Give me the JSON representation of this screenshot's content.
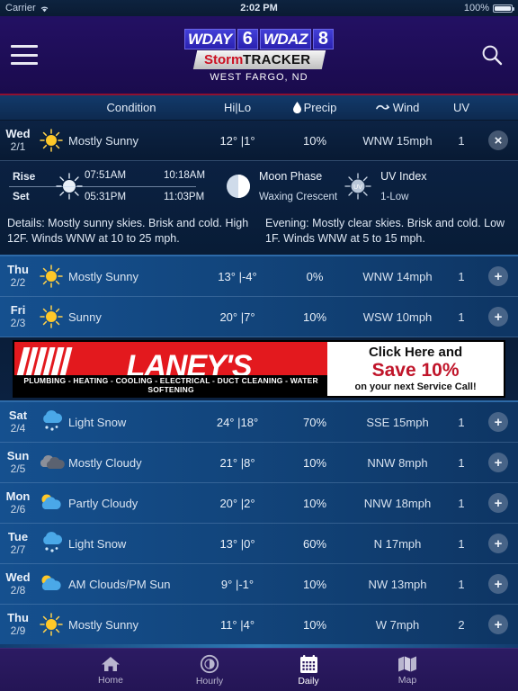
{
  "statusbar": {
    "carrier": "Carrier",
    "time": "2:02 PM",
    "battery": "100%"
  },
  "nav": {
    "menu_icon": "hamburger-icon",
    "search_icon": "search-icon",
    "logo": {
      "box1": "WDAY",
      "num1": "6",
      "box2": "WDAZ",
      "num2": "8",
      "storm": "Storm",
      "tracker": "TRACKER"
    },
    "city": "WEST FARGO, ND"
  },
  "columns": {
    "condition": "Condition",
    "temp": "Hi|Lo",
    "precip": "Precip",
    "wind": "Wind",
    "uv": "UV"
  },
  "forecast": [
    {
      "day": "Wed",
      "date": "2/1",
      "icon": "sunny-icon",
      "condition": "Mostly Sunny",
      "temp": "12° |1°",
      "precip": "10%",
      "wind": "WNW 15mph",
      "uv": "1",
      "expanded": true,
      "button": "×",
      "button_name": "collapse-button"
    },
    {
      "day": "Thu",
      "date": "2/2",
      "icon": "sunny-icon",
      "condition": "Mostly Sunny",
      "temp": "13° |-4°",
      "precip": "0%",
      "wind": "WNW 14mph",
      "uv": "1",
      "expanded": false,
      "button": "+",
      "button_name": "expand-button"
    },
    {
      "day": "Fri",
      "date": "2/3",
      "icon": "sunny-icon",
      "condition": "Sunny",
      "temp": "20° |7°",
      "precip": "10%",
      "wind": "WSW 10mph",
      "uv": "1",
      "expanded": false,
      "button": "+",
      "button_name": "expand-button"
    },
    {
      "day": "Sat",
      "date": "2/4",
      "icon": "snow-icon",
      "condition": "Light Snow",
      "temp": "24° |18°",
      "precip": "70%",
      "wind": "SSE 15mph",
      "uv": "1",
      "expanded": false,
      "button": "+",
      "button_name": "expand-button"
    },
    {
      "day": "Sun",
      "date": "2/5",
      "icon": "cloudy-icon",
      "condition": "Mostly Cloudy",
      "temp": "21° |8°",
      "precip": "10%",
      "wind": "NNW 8mph",
      "uv": "1",
      "expanded": false,
      "button": "+",
      "button_name": "expand-button"
    },
    {
      "day": "Mon",
      "date": "2/6",
      "icon": "partly-cloudy-icon",
      "condition": "Partly Cloudy",
      "temp": "20° |2°",
      "precip": "10%",
      "wind": "NNW 18mph",
      "uv": "1",
      "expanded": false,
      "button": "+",
      "button_name": "expand-button"
    },
    {
      "day": "Tue",
      "date": "2/7",
      "icon": "snow-icon",
      "condition": "Light Snow",
      "temp": "13° |0°",
      "precip": "60%",
      "wind": "N 17mph",
      "uv": "1",
      "expanded": false,
      "button": "+",
      "button_name": "expand-button"
    },
    {
      "day": "Wed",
      "date": "2/8",
      "icon": "partly-cloudy-icon",
      "condition": "AM Clouds/PM Sun",
      "temp": "9° |-1°",
      "precip": "10%",
      "wind": "NW 13mph",
      "uv": "1",
      "expanded": false,
      "button": "+",
      "button_name": "expand-button"
    },
    {
      "day": "Thu",
      "date": "2/9",
      "icon": "sunny-icon",
      "condition": "Mostly Sunny",
      "temp": "11° |4°",
      "precip": "10%",
      "wind": "W 7mph",
      "uv": "2",
      "expanded": false,
      "button": "+",
      "button_name": "expand-button"
    }
  ],
  "detail": {
    "rise_label": "Rise",
    "set_label": "Set",
    "sun_rise": "07:51AM",
    "sun_set": "05:31PM",
    "moon_rise": "10:18AM",
    "moon_set": "11:03PM",
    "moon_phase_label": "Moon Phase",
    "moon_phase_value": "Waxing Crescent",
    "uv_index_label": "UV Index",
    "uv_index_value": "1-Low",
    "details_day": "Details: Mostly sunny skies. Brisk and cold. High 12F. Winds WNW at 10 to 25 mph.",
    "details_evening": "Evening: Mostly clear skies. Brisk and cold. Low 1F. Winds WNW at 5 to 15 mph."
  },
  "ad": {
    "brand": "LANEY'S",
    "services": "PLUMBING - HEATING - COOLING - ELECTRICAL - DUCT CLEANING - WATER SOFTENING",
    "line1": "Click Here and",
    "line2": "Save 10%",
    "line3": "on your next Service Call!"
  },
  "tabs": [
    {
      "label": "Home",
      "icon": "home-icon",
      "active": false
    },
    {
      "label": "Hourly",
      "icon": "clock-icon",
      "active": false
    },
    {
      "label": "Daily",
      "icon": "calendar-icon",
      "active": true
    },
    {
      "label": "Map",
      "icon": "map-icon",
      "active": false
    }
  ],
  "colors": {
    "nav_purple": "#200f5c",
    "accent_red": "#8f1030",
    "row_light": "#15508f",
    "row_dark": "#0c2344",
    "sun_yellow": "#ffc828",
    "ad_red": "#e3191e"
  }
}
